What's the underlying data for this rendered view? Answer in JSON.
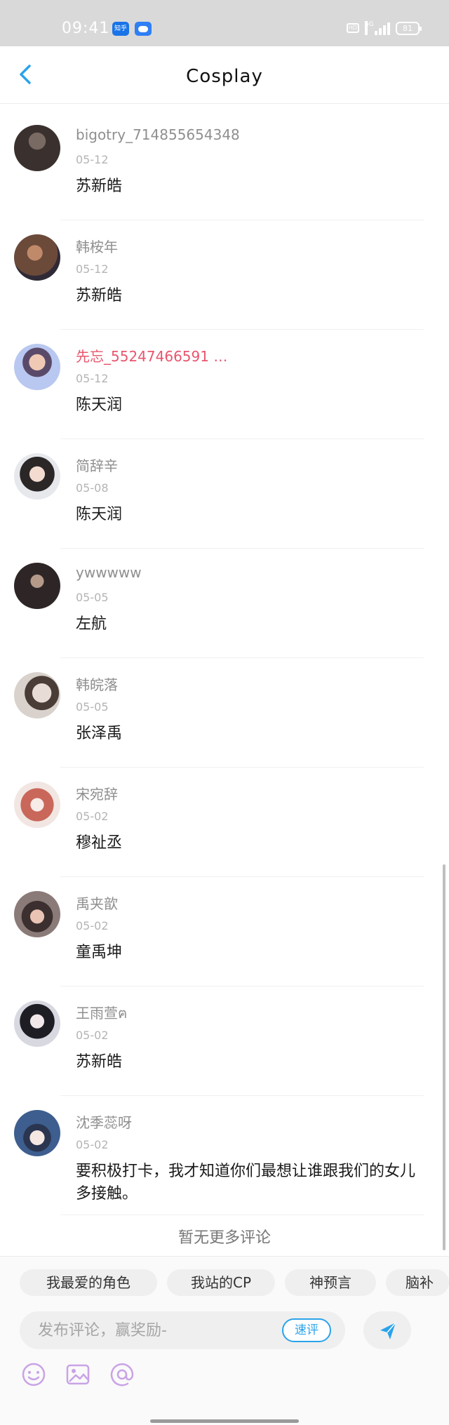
{
  "status_bar": {
    "time": "09:41",
    "app1": "知乎",
    "hd": "HD",
    "network": "5G",
    "battery": "81"
  },
  "header": {
    "title": "Cosplay"
  },
  "comments": [
    {
      "name": "bigotry_714855654348",
      "date": "05-12",
      "text": "苏新皓",
      "name_color": "#8f8f8f",
      "avatar_color": "#3a302e"
    },
    {
      "name": "韩桉年",
      "date": "05-12",
      "text": "苏新皓",
      "name_color": "#8f8f8f",
      "avatar_color": "#6b4a3a"
    },
    {
      "name": "先忘_55247466591 …",
      "date": "05-12",
      "text": "陈天润",
      "name_color": "#e8566e",
      "avatar_color": "#8fa6d9"
    },
    {
      "name": "简辞辛",
      "date": "05-08",
      "text": "陈天润",
      "name_color": "#8f8f8f",
      "avatar_color": "#c8cbd2"
    },
    {
      "name": "ywwwww",
      "date": "05-05",
      "text": "左航",
      "name_color": "#8f8f8f",
      "avatar_color": "#2e2626"
    },
    {
      "name": "韩皖落",
      "date": "05-05",
      "text": "张泽禹",
      "name_color": "#8f8f8f",
      "avatar_color": "#bfb6ae"
    },
    {
      "name": "宋宛辞",
      "date": "05-02",
      "text": "穆祉丞",
      "name_color": "#8f8f8f",
      "avatar_color": "#d7a6a0"
    },
    {
      "name": "禹夹歆",
      "date": "05-02",
      "text": "童禹坤",
      "name_color": "#8f8f8f",
      "avatar_color": "#6a5a57"
    },
    {
      "name": "王雨萱ฅ",
      "date": "05-02",
      "text": "苏新皓",
      "name_color": "#8f8f8f",
      "avatar_color": "#5c5f6b"
    },
    {
      "name": "沈季蕊呀",
      "date": "05-02",
      "text": "要积极打卡，我才知道你们最想让谁跟我们的女儿多接触。",
      "name_color": "#8f8f8f",
      "avatar_color": "#3d5e8e"
    }
  ],
  "no_more": "暂无更多评论",
  "chips": [
    "我最爱的角色",
    "我站的CP",
    "神预言",
    "脑补"
  ],
  "input": {
    "placeholder": "发布评论，赢奖励-",
    "quick_label": "速评"
  },
  "icons": {
    "back": "chevron-left-icon",
    "send": "send-arrow-icon",
    "emoji": "emoji-icon",
    "image": "image-icon",
    "mention": "at-mention-icon"
  },
  "colors": {
    "accent": "#2aa3ea",
    "highlight_name": "#e8566e"
  }
}
